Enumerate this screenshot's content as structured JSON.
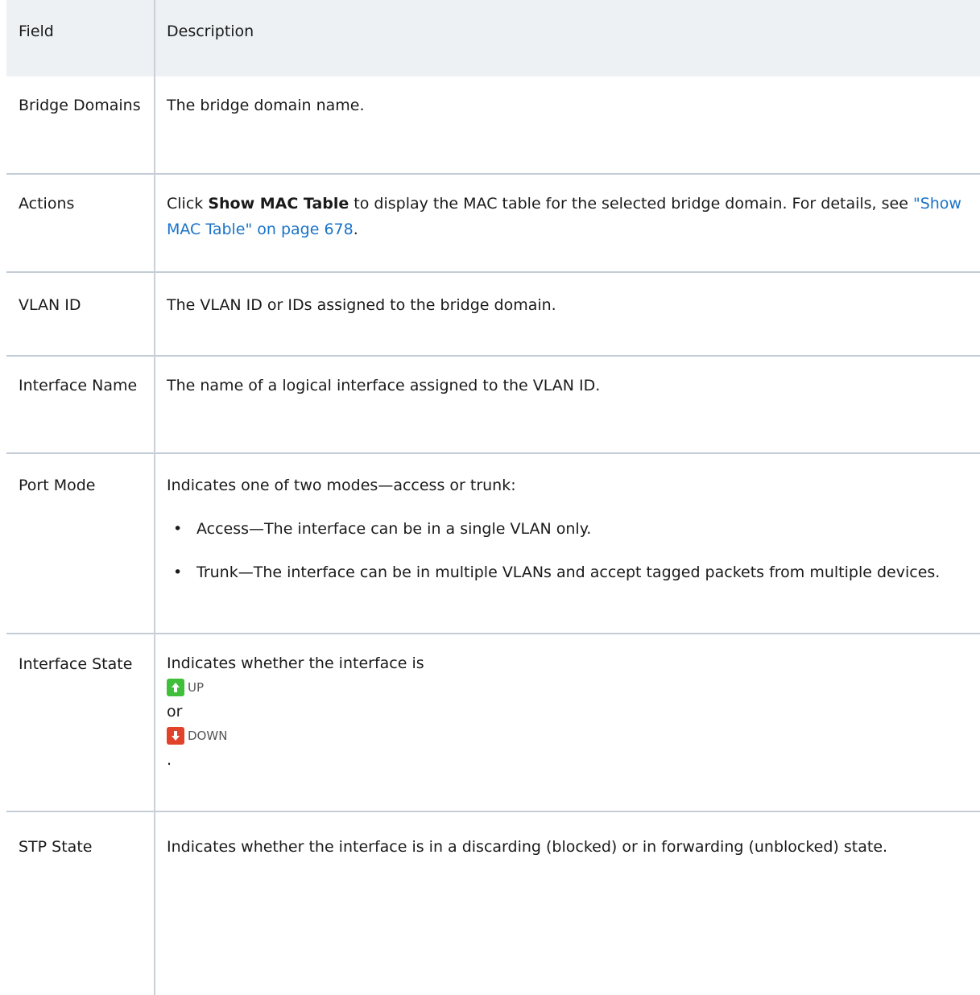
{
  "header": {
    "field": "Field",
    "description": "Description"
  },
  "rows": {
    "bridge": {
      "field": "Bridge Domains",
      "description": "The bridge domain name."
    },
    "actions": {
      "field": "Actions",
      "pre": "Click ",
      "bold": "Show MAC Table",
      "post": " to display the MAC table for the selected bridge domain. For details, see ",
      "link": "\"Show MAC Table\" on page 678",
      "end": "."
    },
    "vlan": {
      "field": "VLAN ID",
      "description": "The VLAN ID or IDs assigned to the bridge domain."
    },
    "iface": {
      "field": "Interface Name",
      "description": "The name of a logical interface assigned to the VLAN ID."
    },
    "port": {
      "field": "Port Mode",
      "intro": "Indicates one of two modes—access or trunk:",
      "bullets": [
        "Access—The interface can be in a single VLAN only.",
        "Trunk—The interface can be in multiple VLANs and accept tagged packets from multiple devices."
      ]
    },
    "state": {
      "field": "Interface State",
      "intro": "Indicates whether the interface is",
      "up_label": "UP",
      "or": "or",
      "down_label": "DOWN",
      "end": "."
    },
    "stp": {
      "field": "STP State",
      "description": "Indicates whether the interface is in a discarding (blocked) or in forwarding (unblocked) state."
    }
  },
  "colors": {
    "link": "#1a73c9",
    "up": "#3fbf3a",
    "down": "#e1422a",
    "header_bg": "#eef1f4",
    "border": "#c4ccd6"
  }
}
